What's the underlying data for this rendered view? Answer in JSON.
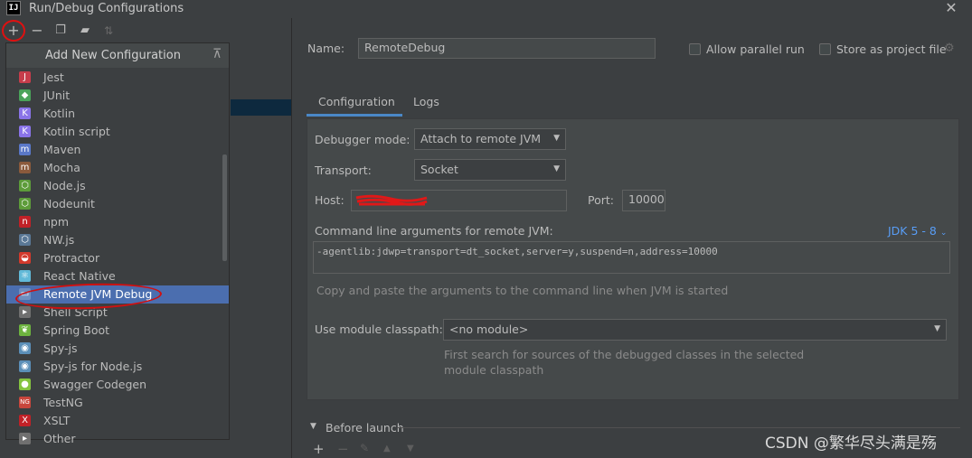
{
  "window": {
    "title": "Run/Debug Configurations",
    "logo_text": "IJ"
  },
  "toolbar": {
    "icons": [
      "add-icon",
      "remove-icon",
      "copy-icon",
      "folder-add-icon",
      "sort-icon"
    ]
  },
  "popup": {
    "title": "Add New Configuration",
    "items": [
      {
        "label": "Jest",
        "icon": "jest-icon",
        "color": "#c63d4b"
      },
      {
        "label": "JUnit",
        "icon": "junit-icon",
        "color": "#4aa35a"
      },
      {
        "label": "Kotlin",
        "icon": "kotlin-icon",
        "color": "#8a74e8"
      },
      {
        "label": "Kotlin script",
        "icon": "kotlin-script-icon",
        "color": "#8a74e8"
      },
      {
        "label": "Maven",
        "icon": "maven-icon",
        "color": "#5a78c8"
      },
      {
        "label": "Mocha",
        "icon": "mocha-icon",
        "color": "#8b5a3c"
      },
      {
        "label": "Node.js",
        "icon": "nodejs-icon",
        "color": "#5d9c3a"
      },
      {
        "label": "Nodeunit",
        "icon": "nodeunit-icon",
        "color": "#5d9c3a"
      },
      {
        "label": "npm",
        "icon": "npm-icon",
        "color": "#c12127"
      },
      {
        "label": "NW.js",
        "icon": "nwjs-icon",
        "color": "#5a7896"
      },
      {
        "label": "Protractor",
        "icon": "protractor-icon",
        "color": "#d33a2c"
      },
      {
        "label": "React Native",
        "icon": "react-icon",
        "color": "#61b9d8"
      },
      {
        "label": "Remote JVM Debug",
        "icon": "remote-debug-icon",
        "color": "#6f8fbf",
        "selected": true
      },
      {
        "label": "Shell Script",
        "icon": "shell-script-icon",
        "color": "#707070"
      },
      {
        "label": "Spring Boot",
        "icon": "spring-boot-icon",
        "color": "#6db33f"
      },
      {
        "label": "Spy-js",
        "icon": "spyjs-icon",
        "color": "#5b8fb8"
      },
      {
        "label": "Spy-js for Node.js",
        "icon": "spyjs-node-icon",
        "color": "#5b8fb8"
      },
      {
        "label": "Swagger Codegen",
        "icon": "swagger-icon",
        "color": "#85c440"
      },
      {
        "label": "TestNG",
        "icon": "testng-icon",
        "color": "#c8463c"
      },
      {
        "label": "XSLT",
        "icon": "xslt-icon",
        "color": "#c12127"
      },
      {
        "label": "Other",
        "icon": "other-icon",
        "color": "#707070"
      }
    ]
  },
  "form": {
    "name_label": "Name:",
    "name_value": "RemoteDebug",
    "allow_parallel_label": "Allow parallel run",
    "store_label": "Store as project file",
    "tabs": [
      "Configuration",
      "Logs"
    ],
    "debugger_mode_label": "Debugger mode:",
    "debugger_mode_value": "Attach to remote JVM",
    "transport_label": "Transport:",
    "transport_value": "Socket",
    "host_label": "Host:",
    "port_label": "Port:",
    "port_value": "10000",
    "cmdline_label": "Command line arguments for remote JVM:",
    "jdk_link": "JDK 5 - 8",
    "cmdline_value": "-agentlib:jdwp=transport=dt_socket,server=y,suspend=n,address=10000",
    "cmdline_hint": "Copy and paste the arguments to the command line when JVM is started",
    "module_label": "Use module classpath:",
    "module_value": "<no module>",
    "module_hint_1": "First search for sources of the debugged classes in the selected",
    "module_hint_2": "module classpath",
    "before_launch_label": "Before launch"
  },
  "watermark": "CSDN @繁华尽头满是殇",
  "colors": {
    "selection": "#4b6eaf",
    "link": "#589df6",
    "tab_underline": "#4a88c7",
    "annotation": "#e01010"
  }
}
